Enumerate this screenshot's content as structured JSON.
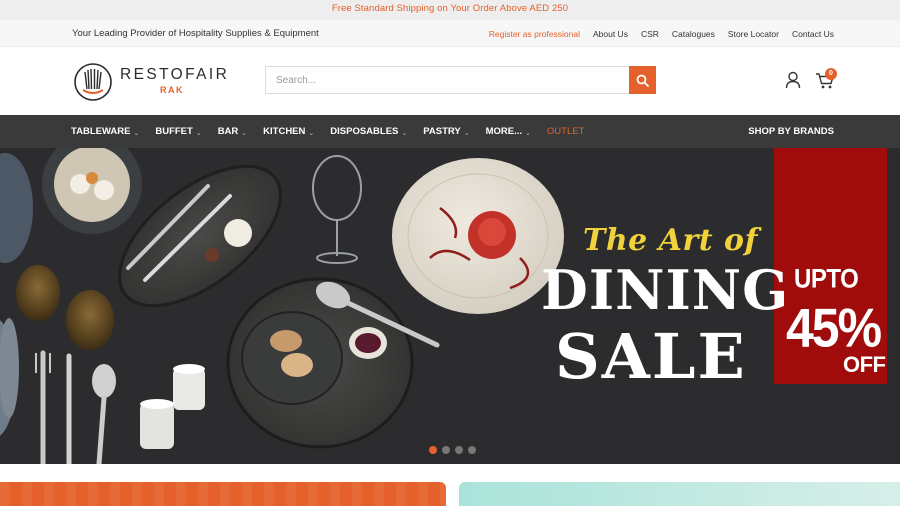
{
  "promo": {
    "text": "Free Standard Shipping on Your Order Above AED 250"
  },
  "top_bar": {
    "tagline": "Your Leading Provider of Hospitality Supplies & Equipment",
    "links": [
      "Register as professional",
      "About Us",
      "CSR",
      "Catalogues",
      "Store Locator",
      "Contact Us"
    ]
  },
  "header": {
    "logo_name": "RESTOFAIR",
    "logo_sub": "RAK",
    "search_placeholder": "Search...",
    "cart_count": "0"
  },
  "nav": {
    "items": [
      "TABLEWARE",
      "BUFFET",
      "BAR",
      "KITCHEN",
      "DISPOSABLES",
      "PASTRY",
      "MORE..."
    ],
    "outlet": "OUTLET",
    "brands": "SHOP BY BRANDS"
  },
  "hero": {
    "line1": "The Art of",
    "line2": "DINING",
    "line3": "SALE",
    "badge_top": "UPTO",
    "badge_pct": "45%",
    "badge_bottom": "OFF",
    "slide_count": 4,
    "active_slide": 1
  },
  "colors": {
    "accent": "#e4612b",
    "nav_bg": "#3a3a3a",
    "hero_bg": "#2d2d2f",
    "sale_badge": "#a00c0c",
    "headline_yellow": "#f1d23a"
  },
  "icons": [
    "search-icon",
    "user-icon",
    "cart-icon",
    "chevron-down-icon"
  ]
}
